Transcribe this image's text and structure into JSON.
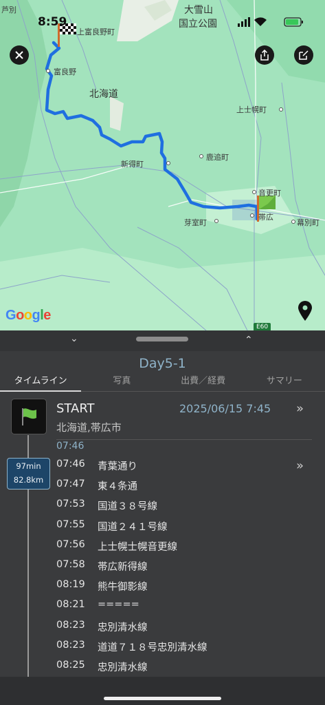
{
  "status_bar": {
    "time": "8:59"
  },
  "map": {
    "labels": {
      "ashibetsu": "芦別",
      "taisetsuzan": "大雪山",
      "kokuritsu_koen": "国立公園",
      "kamifurano": "上富良野町",
      "furano": "富良野",
      "hokkaido": "北海道",
      "kamishihoro": "上士幌町",
      "shikaoi": "鹿追町",
      "shintoku": "新得町",
      "otofuke": "音更町",
      "memuro": "芽室町",
      "obihiro": "帯広",
      "makubetsu": "幕別町",
      "road_e60": "E60"
    },
    "attribution": "Google",
    "colors": {
      "route": "#1f6fe0",
      "land": "#9ee0b8"
    }
  },
  "toolbar": {
    "close_icon": "close-icon",
    "share_icon": "share-icon",
    "edit_icon": "edit-icon",
    "pin_icon": "location-pin-icon"
  },
  "panel": {
    "collapse_icon": "chevron-down-icon",
    "expand_icon": "chevron-up-icon",
    "title": "Day5-1",
    "tabs": [
      "タイムライン",
      "写真",
      "出費／経費",
      "サマリー"
    ],
    "start": {
      "label": "START",
      "datetime": "2025/06/15 7:45",
      "place": "北海道,帯広市",
      "time": "07:46"
    },
    "segment": {
      "duration": "97min",
      "distance": "82.8km"
    },
    "timeline": [
      {
        "time": "07:46",
        "name": "青葉通り"
      },
      {
        "time": "07:47",
        "name": "東４条通"
      },
      {
        "time": "07:53",
        "name": "国道３８号線"
      },
      {
        "time": "07:55",
        "name": "国道２４１号線"
      },
      {
        "time": "07:56",
        "name": "上士幌士幌音更線"
      },
      {
        "time": "07:58",
        "name": "帯広新得線"
      },
      {
        "time": "08:19",
        "name": "熊牛御影線"
      },
      {
        "time": "08:21",
        "name": "====="
      },
      {
        "time": "08:23",
        "name": "忠別清水線"
      },
      {
        "time": "08:23",
        "name": "道道７１８号忠別清水線"
      },
      {
        "time": "08:25",
        "name": "忠別清水線"
      }
    ]
  }
}
